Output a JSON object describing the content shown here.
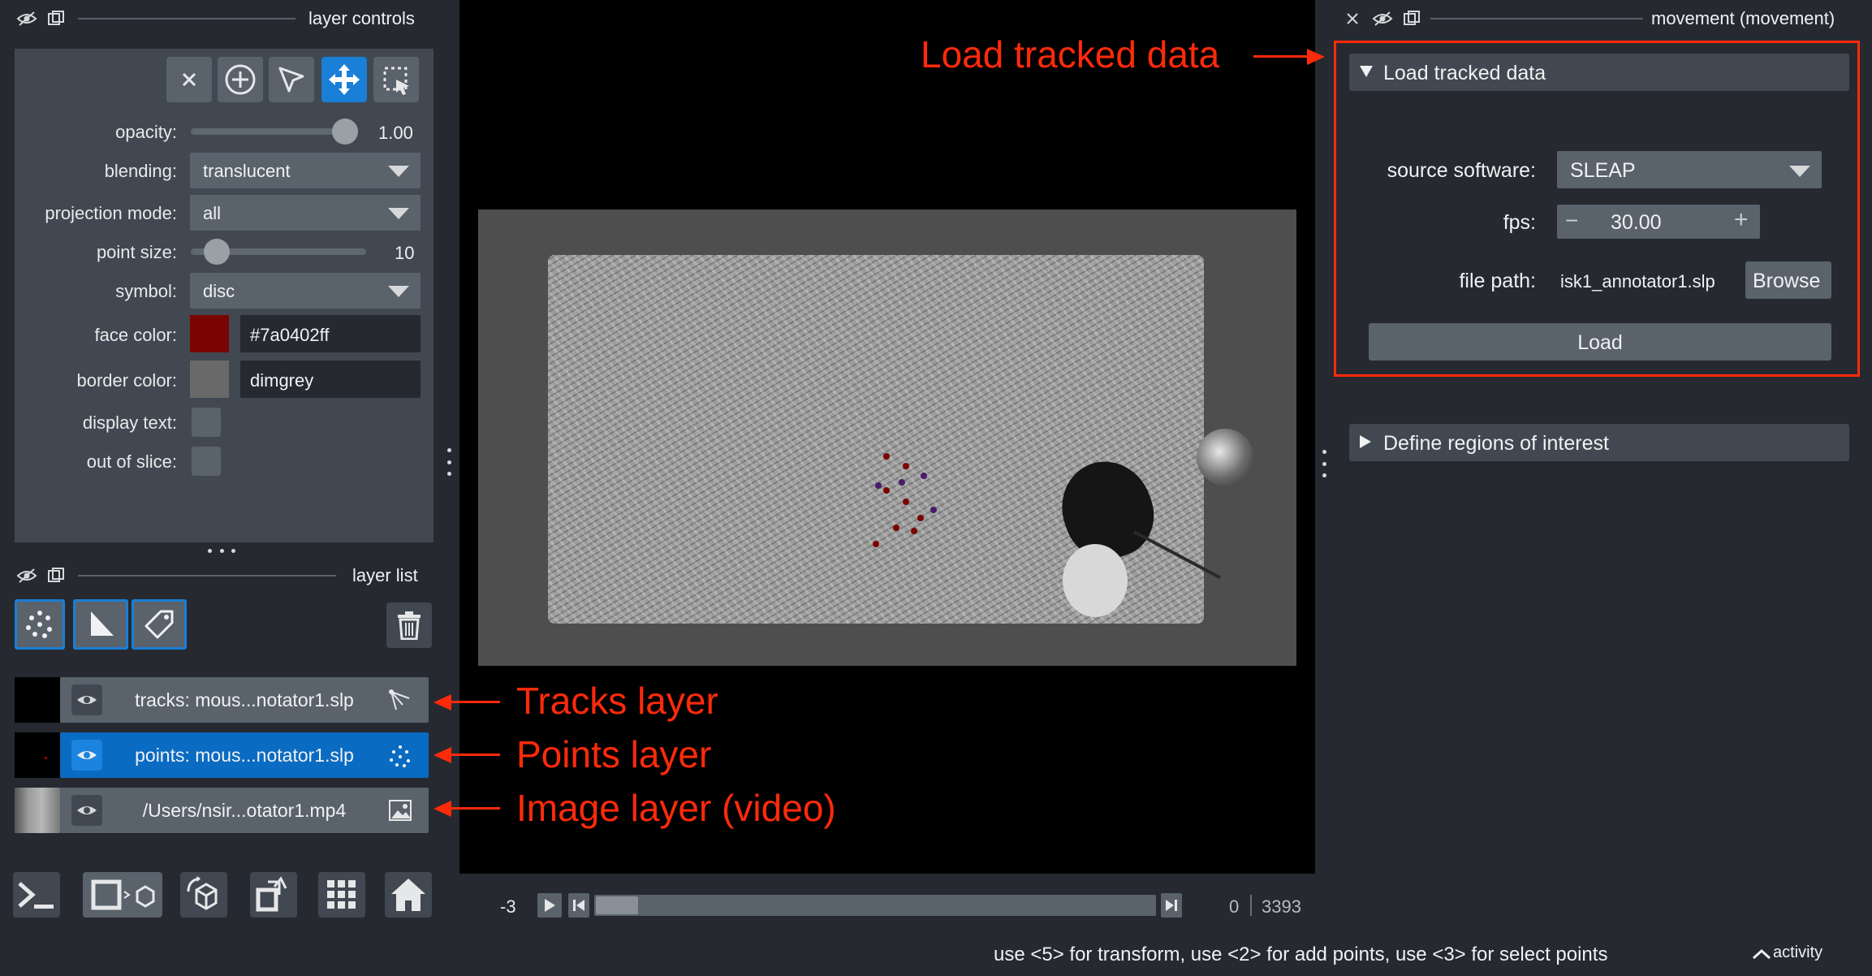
{
  "left_panel": {
    "controls_title": "layer controls",
    "opacity_label": "opacity:",
    "opacity_value": "1.00",
    "blending_label": "blending:",
    "blending_value": "translucent",
    "projection_label": "projection mode:",
    "projection_value": "all",
    "point_size_label": "point size:",
    "point_size_value": "10",
    "symbol_label": "symbol:",
    "symbol_value": "disc",
    "face_color_label": "face color:",
    "face_color_value": "#7a0402ff",
    "face_color_hex": "#7a0402",
    "border_color_label": "border color:",
    "border_color_value": "dimgrey",
    "display_text_label": "display text:",
    "out_of_slice_label": "out of slice:",
    "layer_list_title": "layer list",
    "layers": [
      {
        "name": "tracks: mous...notator1.slp",
        "icon": "tracks-icon",
        "selected": false
      },
      {
        "name": "points: mous...notator1.slp",
        "icon": "points-icon",
        "selected": true
      },
      {
        "name": "/Users/nsir...otator1.mp4",
        "icon": "image-icon",
        "selected": false
      }
    ]
  },
  "right_panel": {
    "title": "movement (movement)",
    "section_load": "Load tracked data",
    "source_label": "source software:",
    "source_value": "SLEAP",
    "fps_label": "fps:",
    "fps_value": "30.00",
    "file_path_label": "file path:",
    "file_path_value": "isk1_annotator1.slp",
    "browse_label": "Browse",
    "load_label": "Load",
    "section_roi": "Define regions of interest"
  },
  "timeline": {
    "frame_value": "-3",
    "current": "0",
    "total": "3393"
  },
  "status": {
    "message": "use <5> for transform, use <2> for add points, use <3> for select points",
    "activity": "activity"
  },
  "annotations": {
    "load": "Load tracked data",
    "tracks": "Tracks layer",
    "points": "Points layer",
    "image": "Image layer (video)"
  },
  "colors": {
    "accent": "#1a7fd6",
    "annotation": "#ff2a0a",
    "background": "#262930",
    "panel": "#414851"
  }
}
